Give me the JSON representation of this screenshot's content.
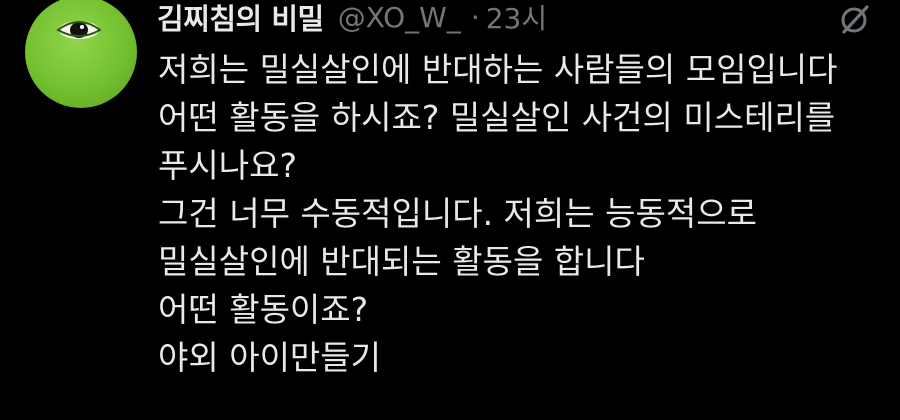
{
  "tweet": {
    "display_name": "김찌침의 비밀",
    "handle": "@XO_W_",
    "separator": "·",
    "timestamp": "23시",
    "lines": [
      "저희는 밀실살인에 반대하는 사람들의 모임입니다",
      "어떤 활동을 하시죠? 밀실살인 사건의 미스테리를",
      "푸시나요?",
      "그건 너무 수동적입니다. 저희는 능동적으로",
      "밀실살인에 반대되는 활동을 합니다",
      "어떤 활동이죠?",
      "야외 아이만들기"
    ]
  },
  "icons": {
    "avatar": "green-eye-avatar",
    "grok": "grok-icon"
  },
  "colors": {
    "background": "#000000",
    "text": "#e7e9ea",
    "secondary": "#71767b",
    "avatar_green": "#74c02f"
  }
}
